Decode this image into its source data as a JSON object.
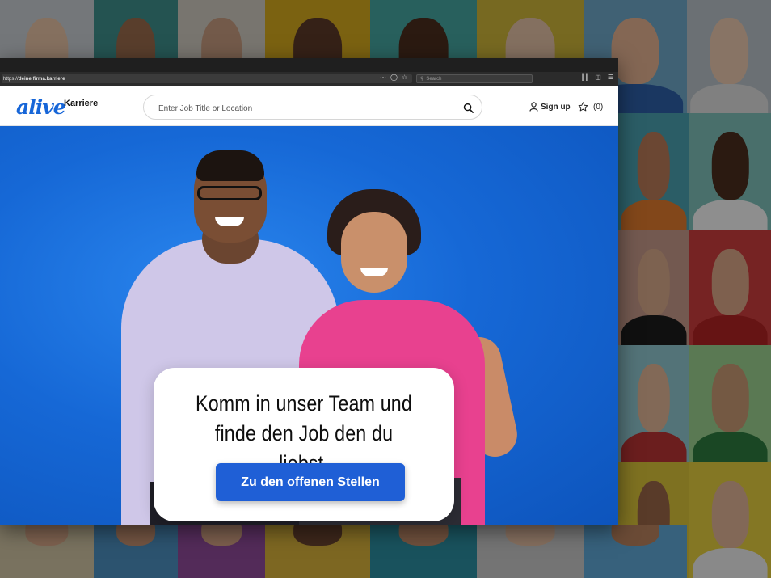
{
  "browser": {
    "url_prefix": "https://",
    "url_domain": "deine firma.karriere",
    "search_placeholder": "Search",
    "icons": [
      "more-icon",
      "pocket-icon",
      "bookmark-star-icon",
      "library-icon",
      "sidebar-icon",
      "menu-icon"
    ]
  },
  "site": {
    "logo_text": "alive",
    "logo_sub": "Karriere",
    "search_placeholder": "Enter Job Title or Location",
    "signup_label": "Sign up",
    "favorites_count": "(0)",
    "brand_color": "#1766d8"
  },
  "hero": {
    "title_line1": "Komm in unser Team und",
    "title_line2": "finde den Job den du liebst.",
    "cta_label": "Zu den offenen Stellen",
    "cta_color": "#1f5fd6"
  }
}
